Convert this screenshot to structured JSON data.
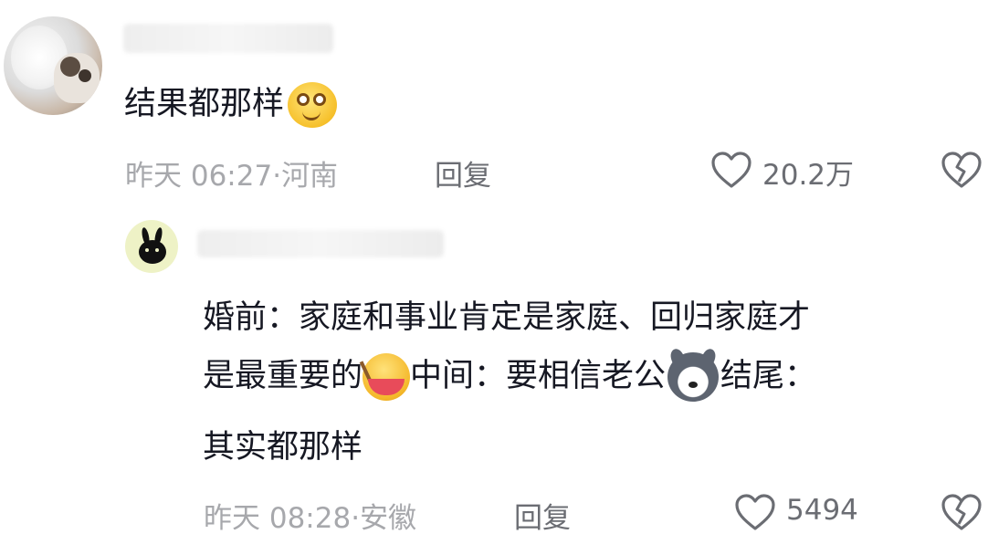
{
  "comments": [
    {
      "text_before_emoji": "结果都那样",
      "emoji": "smiling-face-emoji",
      "time": "昨天 06:27",
      "location": "河南",
      "reply_label": "回复",
      "like_count": "20.2万",
      "icons": {
        "like": "heart-outline-icon",
        "dislike": "broken-heart-icon"
      }
    },
    {
      "line1": "婚前：家庭和事业肯定是家庭、回归家庭才",
      "line2_part1": "是最重要的",
      "line2_emoji1": "eating-noodles-emoji",
      "line2_part2": "中间：要相信老公",
      "line2_emoji2": "husky-dog-emoji",
      "line2_part3": "结尾：",
      "line3": "其实都那样",
      "time": "昨天 08:28",
      "location": "安徽",
      "reply_label": "回复",
      "like_count": "5494",
      "icons": {
        "like": "heart-outline-icon",
        "dislike": "broken-heart-icon"
      }
    }
  ],
  "colors": {
    "text": "#161823",
    "meta": "#a7a8ac",
    "action": "#6b6d73"
  }
}
